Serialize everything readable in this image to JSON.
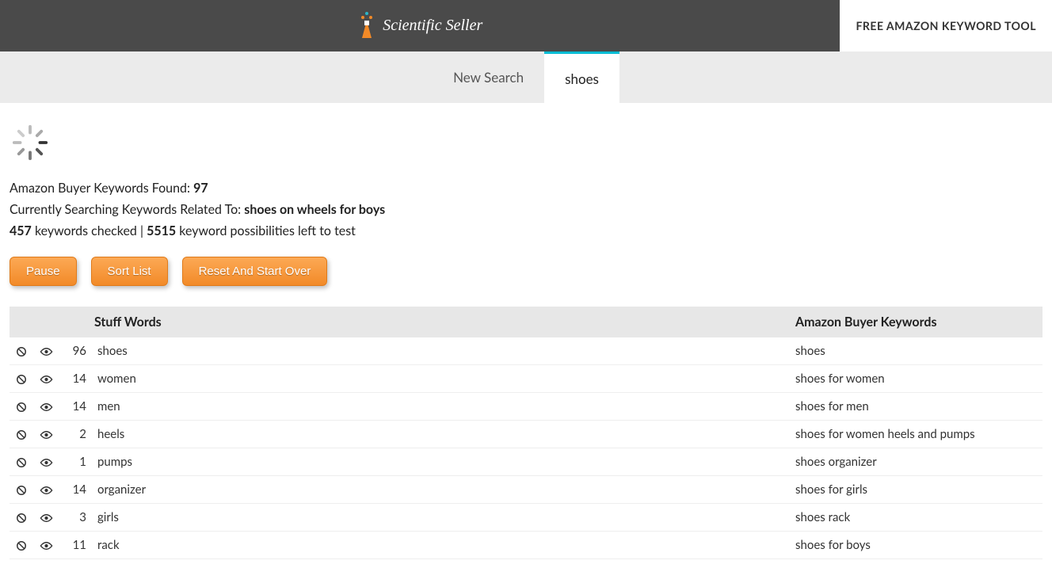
{
  "header": {
    "brand": "Scientific Seller",
    "cta": "FREE AMAZON KEYWORD TOOL"
  },
  "tabs": {
    "new_search": "New Search",
    "active": "shoes"
  },
  "status": {
    "found_label": "Amazon Buyer Keywords Found: ",
    "found_count": "97",
    "searching_label": "Currently Searching Keywords Related To: ",
    "searching_term": "shoes on wheels for boys",
    "checked_count": "457",
    "checked_label": " keywords checked | ",
    "possibilities_count": "5515",
    "possibilities_label": " keyword possibilities left to test"
  },
  "buttons": {
    "pause": "Pause",
    "sort": "Sort List",
    "reset": "Reset And Start Over"
  },
  "columns": {
    "stuff": "Stuff Words",
    "buyer": "Amazon Buyer Keywords"
  },
  "rows": [
    {
      "count": "96",
      "stuff": "shoes",
      "buyer": "shoes"
    },
    {
      "count": "14",
      "stuff": "women",
      "buyer": "shoes for women"
    },
    {
      "count": "14",
      "stuff": "men",
      "buyer": "shoes for men"
    },
    {
      "count": "2",
      "stuff": "heels",
      "buyer": "shoes for women heels and pumps"
    },
    {
      "count": "1",
      "stuff": "pumps",
      "buyer": "shoes organizer"
    },
    {
      "count": "14",
      "stuff": "organizer",
      "buyer": "shoes for girls"
    },
    {
      "count": "3",
      "stuff": "girls",
      "buyer": "shoes rack"
    },
    {
      "count": "11",
      "stuff": "rack",
      "buyer": "shoes for boys"
    }
  ]
}
